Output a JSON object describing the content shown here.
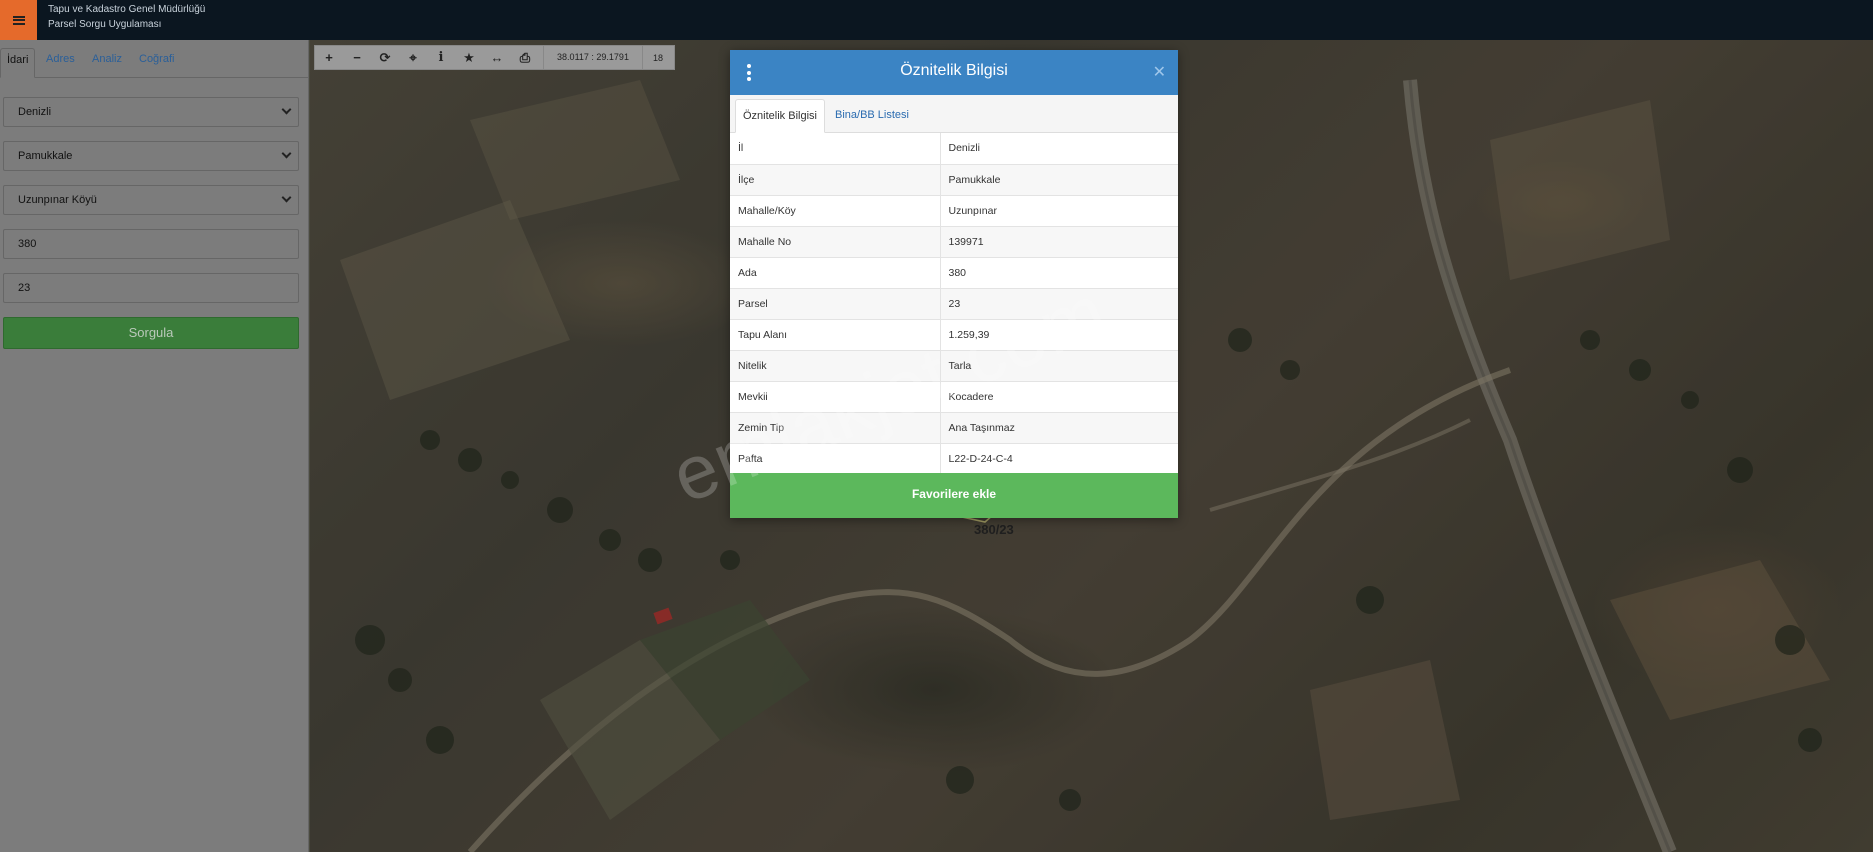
{
  "header": {
    "org_name": "Tapu ve Kadastro Genel Müdürlüğü",
    "app_name": "Parsel Sorgu Uygulaması",
    "menu_icon": "hamburger-icon",
    "accent_color": "#e56a2b"
  },
  "sidebar": {
    "tabs": [
      {
        "label": "İdari",
        "active": true
      },
      {
        "label": "Adres",
        "active": false
      },
      {
        "label": "Analiz",
        "active": false
      },
      {
        "label": "Coğrafi",
        "active": false
      }
    ],
    "province_select": "Denizli",
    "district_select": "Pamukkale",
    "neighborhood_select": "Uzunpınar Köyü",
    "block_input": "380",
    "parcel_input": "23",
    "query_button": "Sorgula"
  },
  "map_toolbar": {
    "tools": [
      "plus-icon",
      "minus-icon",
      "refresh-icon",
      "locate-icon",
      "info-icon",
      "star-icon",
      "measure-icon",
      "print-icon"
    ],
    "coordinates": "38.0117 : 29.1791",
    "zoom_level": "18"
  },
  "map": {
    "parcel_label": "380/23",
    "watermark": "emlakjet.com"
  },
  "modal": {
    "title": "Öznitelik Bilgisi",
    "tabs": [
      "Öznitelik Bilgisi",
      "Bina/BB Listesi"
    ],
    "rows": [
      {
        "key": "İl",
        "value": "Denizli"
      },
      {
        "key": "İlçe",
        "value": "Pamukkale"
      },
      {
        "key": "Mahalle/Köy",
        "value": "Uzunpınar"
      },
      {
        "key": "Mahalle No",
        "value": "139971"
      },
      {
        "key": "Ada",
        "value": "380"
      },
      {
        "key": "Parsel",
        "value": "23"
      },
      {
        "key": "Tapu Alanı",
        "value": "1.259,39"
      },
      {
        "key": "Nitelik",
        "value": "Tarla"
      },
      {
        "key": "Mevkii",
        "value": "Kocadere"
      },
      {
        "key": "Zemin Tip",
        "value": "Ana Taşınmaz"
      },
      {
        "key": "Pafta",
        "value": "L22-D-24-C-4"
      }
    ],
    "favorite_button": "Favorilere ekle",
    "header_color": "#3b84c4",
    "button_color": "#5cb85c"
  }
}
